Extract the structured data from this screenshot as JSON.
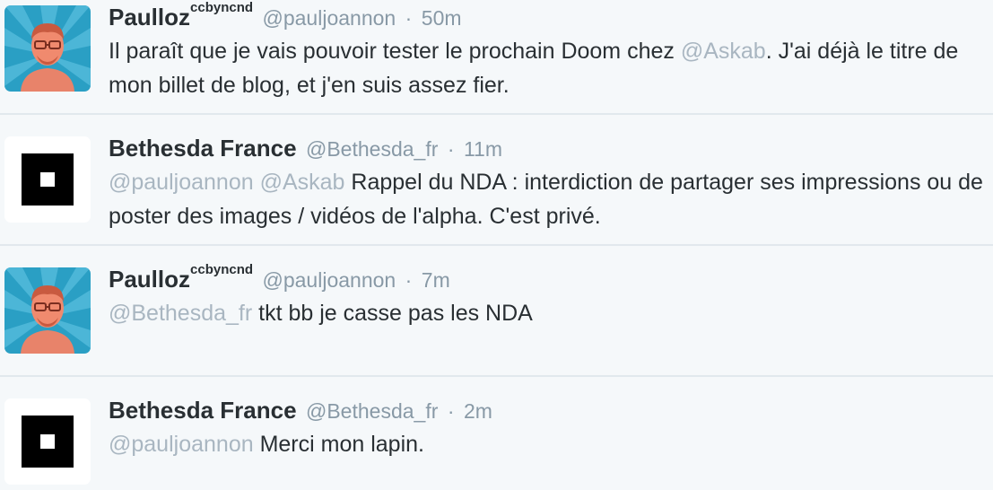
{
  "colors": {
    "background": "#f5f8fa",
    "divider": "#e1e8ed",
    "name": "#292f33",
    "meta": "#8899a6",
    "mention": "#a9b6c1",
    "avatar_rays": "#2a9fc4"
  },
  "tweets": [
    {
      "avatar": "person-photo-avatar",
      "name": "Paulloz",
      "name_sup": "ccbyncnd",
      "handle": "@pauljoannon",
      "separator": "·",
      "time": "50m",
      "text_parts": [
        {
          "text": "Il paraît que je vais pouvoir tester le prochain Doom chez "
        },
        {
          "text": "@Askab",
          "mention": true
        },
        {
          "text": ". J'ai déjà le titre de mon billet de blog, et j'en suis assez fier."
        }
      ]
    },
    {
      "avatar": "bethesda-logo-avatar",
      "name": "Bethesda France",
      "handle": "@Bethesda_fr",
      "separator": "·",
      "time": "11m",
      "text_parts": [
        {
          "text": "@pauljoannon",
          "mention": true
        },
        {
          "text": " "
        },
        {
          "text": "@Askab",
          "mention": true
        },
        {
          "text": " Rappel du NDA : interdiction de partager ses impressions ou de poster des images / vidéos de l'alpha. C'est privé."
        }
      ]
    },
    {
      "avatar": "person-photo-avatar",
      "name": "Paulloz",
      "name_sup": "ccbyncnd",
      "handle": "@pauljoannon",
      "separator": "·",
      "time": "7m",
      "text_parts": [
        {
          "text": "@Bethesda_fr",
          "mention": true
        },
        {
          "text": " tkt bb je casse pas les NDA"
        }
      ]
    },
    {
      "avatar": "bethesda-logo-avatar",
      "name": "Bethesda France",
      "handle": "@Bethesda_fr",
      "separator": "·",
      "time": "2m",
      "text_parts": [
        {
          "text": "@pauljoannon",
          "mention": true
        },
        {
          "text": " Merci mon lapin."
        }
      ]
    }
  ]
}
